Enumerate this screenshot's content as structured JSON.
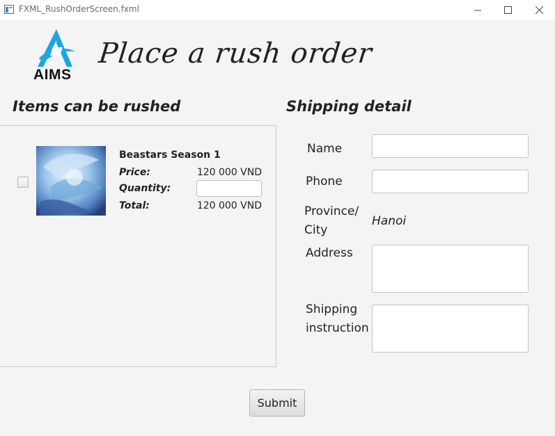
{
  "window": {
    "title": "FXML_RushOrderScreen.fxml",
    "controls": [
      "minimize",
      "maximize",
      "close"
    ]
  },
  "header": {
    "logo_text": "AIMS",
    "title": "Place a rush order"
  },
  "items_section": {
    "title": "Items can be rushed",
    "items": [
      {
        "name": "Beastars Season 1",
        "price_label": "Price:",
        "price_value": "120 000 VND",
        "quantity_label": "Quantity:",
        "quantity_value": "",
        "total_label": "Total:",
        "total_value": "120 000 VND",
        "checked": false
      }
    ]
  },
  "shipping_section": {
    "title": "Shipping detail",
    "name_label": "Name",
    "name_value": "",
    "phone_label": "Phone",
    "phone_value": "",
    "province_label_line1": "Province/",
    "province_label_line2": "City",
    "province_value": "Hanoi",
    "address_label": "Address",
    "address_value": "",
    "instruction_label_line1": "Shipping",
    "instruction_label_line2": "instruction",
    "instruction_value": ""
  },
  "actions": {
    "submit_label": "Submit"
  },
  "colors": {
    "background": "#f4f4f4",
    "logo_blue": "#1aa6e0"
  }
}
